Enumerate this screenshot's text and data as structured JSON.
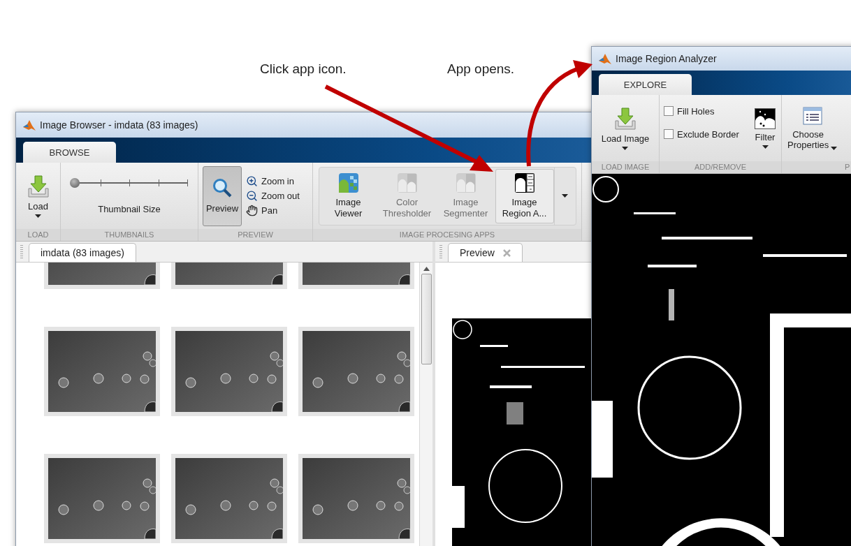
{
  "annotations": [
    {
      "text": "Click app icon."
    },
    {
      "text": "App opens."
    }
  ],
  "image_browser": {
    "title": "Image Browser - imdata (83 images)",
    "tabs": [
      {
        "label": "BROWSE",
        "selected": true
      }
    ],
    "load_group": {
      "label": "LOAD",
      "button": "Load"
    },
    "thumbnails_group": {
      "label": "THUMBNAILS",
      "slider_label": "Thumbnail Size",
      "level": 0.03
    },
    "preview_group": {
      "label": "PREVIEW",
      "toggle": {
        "label": "Preview",
        "selected": true
      },
      "actions": [
        {
          "label": "Zoom in",
          "kind": "zoom-in"
        },
        {
          "label": "Zoom out",
          "kind": "zoom-out"
        },
        {
          "label": "Pan",
          "kind": "pan"
        }
      ]
    },
    "apps_group": {
      "label": "IMAGE PROCESING APPS",
      "apps": [
        {
          "label": "Image\nViewer",
          "kind": "viewer",
          "disabled": false,
          "hovered": false
        },
        {
          "label": "Color\nThresholder",
          "kind": "thresholder",
          "disabled": true,
          "hovered": false
        },
        {
          "label": "Image\nSegmenter",
          "kind": "segmenter",
          "disabled": true,
          "hovered": false
        },
        {
          "label": "Image\nRegion A...",
          "kind": "region",
          "disabled": false,
          "hovered": true
        }
      ]
    },
    "documents": [
      {
        "label": "imdata (83 images)",
        "kind": "thumbnails"
      },
      {
        "label": "Preview",
        "kind": "preview",
        "closable": true
      }
    ]
  },
  "region_analyzer": {
    "title": "Image Region Analyzer",
    "tabs": [
      {
        "label": "EXPLORE",
        "selected": true
      }
    ],
    "load_group": {
      "label": "LOAD IMAGE",
      "button": "Load Image"
    },
    "add_remove_group": {
      "label": "ADD/REMOVE",
      "checkboxes": [
        {
          "label": "Fill Holes",
          "checked": false
        },
        {
          "label": "Exclude Border",
          "checked": false
        }
      ],
      "filter": "Filter"
    },
    "properties_group": {
      "label": "P",
      "button": "Choose\nProperties"
    }
  }
}
